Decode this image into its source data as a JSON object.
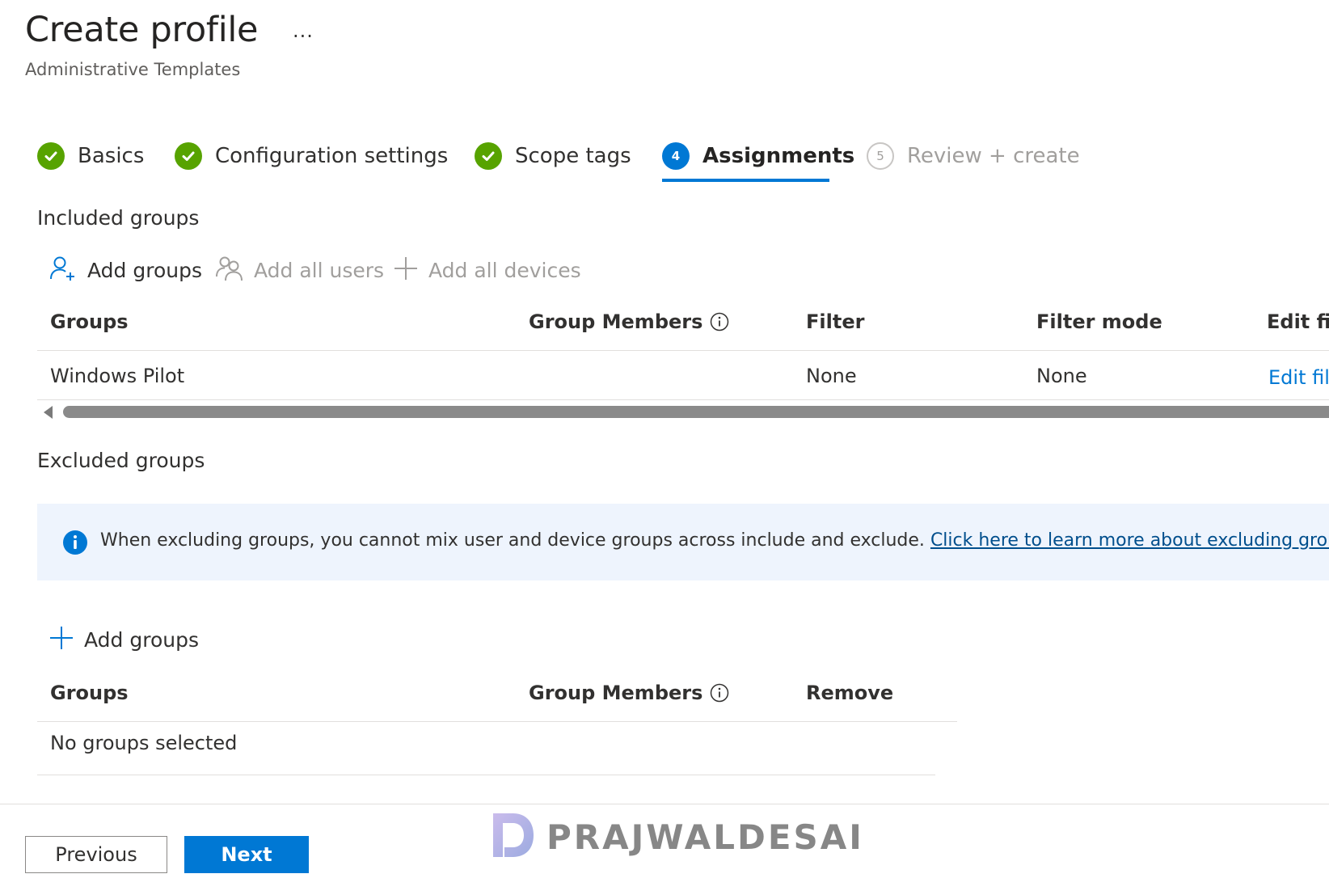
{
  "header": {
    "title": "Create profile",
    "more_label": "...",
    "subtitle": "Administrative Templates"
  },
  "wizard": {
    "steps": [
      {
        "label": "Basics",
        "state": "done",
        "icon": "checkmark-icon"
      },
      {
        "label": "Configuration settings",
        "state": "done",
        "icon": "checkmark-icon"
      },
      {
        "label": "Scope tags",
        "state": "done",
        "icon": "checkmark-icon"
      },
      {
        "label": "Assignments",
        "state": "active",
        "number": "4"
      },
      {
        "label": "Review + create",
        "state": "pending",
        "number": "5"
      }
    ]
  },
  "included": {
    "title": "Included groups",
    "commands": [
      {
        "label": "Add groups",
        "enabled": true,
        "icon": "add-person-icon"
      },
      {
        "label": "Add all users",
        "enabled": false,
        "icon": "people-icon"
      },
      {
        "label": "Add all devices",
        "enabled": false,
        "icon": "plus-icon"
      }
    ],
    "columns": [
      "Groups",
      "Group Members",
      "Filter",
      "Filter mode",
      "Edit filter"
    ],
    "rows": [
      {
        "group": "Windows Pilot",
        "members": "",
        "filter": "None",
        "filter_mode": "None",
        "edit": "Edit filter"
      }
    ]
  },
  "excluded": {
    "title": "Excluded groups",
    "info_text": "When excluding groups, you cannot mix user and device groups across include and exclude.",
    "info_link": "Click here to learn more about excluding groups.",
    "add_label": "Add groups",
    "columns": [
      "Groups",
      "Group Members",
      "Remove"
    ],
    "empty_text": "No groups selected"
  },
  "footer": {
    "previous_label": "Previous",
    "next_label": "Next"
  },
  "watermark": "PRAJWALDESAI",
  "colors": {
    "accent": "#0078d4",
    "success": "#57a300",
    "info_bg": "#eef4fd",
    "link_dark": "#004e8c"
  }
}
